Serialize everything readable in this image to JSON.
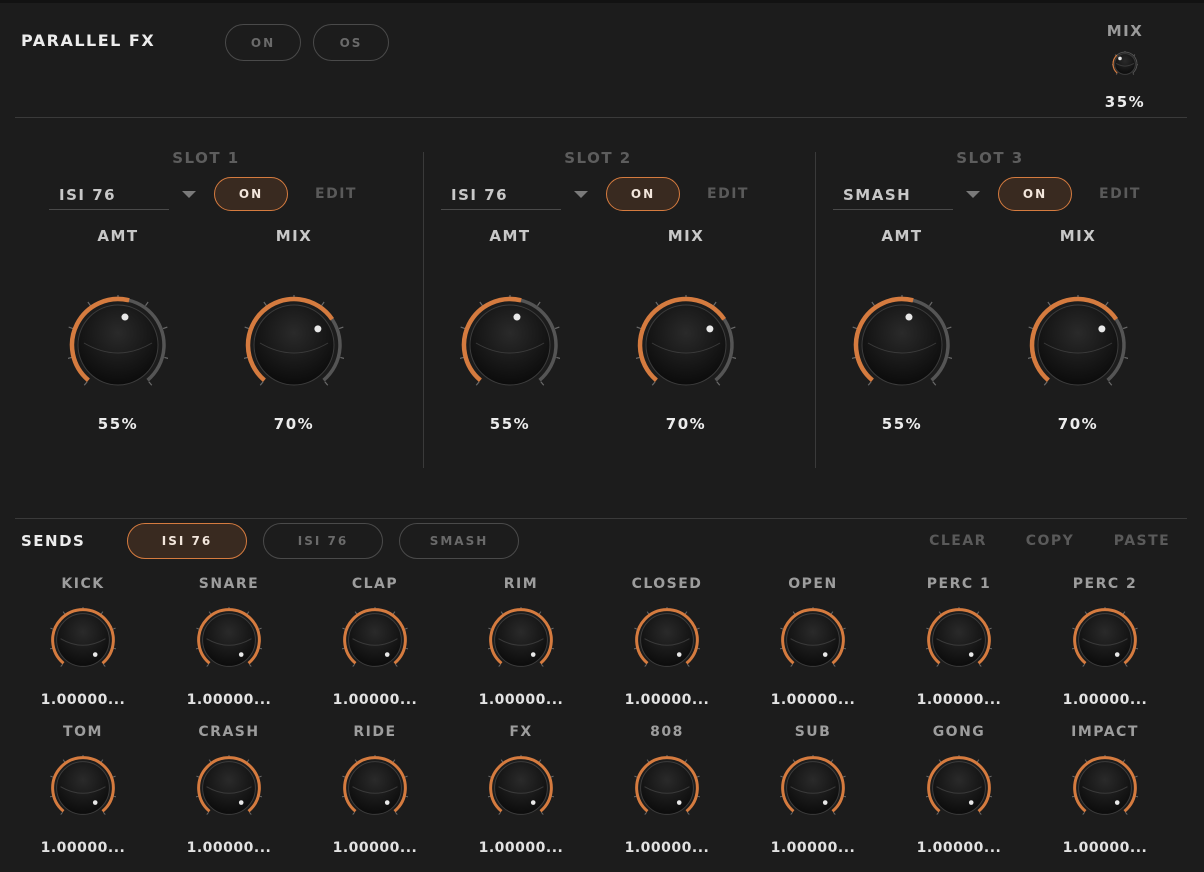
{
  "header": {
    "title": "PARALLEL FX",
    "buttons": [
      {
        "label": "ON",
        "active": false
      },
      {
        "label": "OS",
        "active": false
      }
    ],
    "mix": {
      "label": "MIX",
      "value": "35%",
      "level": 0.35
    }
  },
  "slots": [
    {
      "title": "SLOT 1",
      "effect": "ISI 76",
      "on_label": "ON",
      "on_active": true,
      "edit_label": "EDIT",
      "knobs": [
        {
          "label": "AMT",
          "value": "55%",
          "level": 0.55
        },
        {
          "label": "MIX",
          "value": "70%",
          "level": 0.7
        }
      ]
    },
    {
      "title": "SLOT 2",
      "effect": "ISI 76",
      "on_label": "ON",
      "on_active": true,
      "edit_label": "EDIT",
      "knobs": [
        {
          "label": "AMT",
          "value": "55%",
          "level": 0.55
        },
        {
          "label": "MIX",
          "value": "70%",
          "level": 0.7
        }
      ]
    },
    {
      "title": "SLOT 3",
      "effect": "SMASH",
      "on_label": "ON",
      "on_active": true,
      "edit_label": "EDIT",
      "knobs": [
        {
          "label": "AMT",
          "value": "55%",
          "level": 0.55
        },
        {
          "label": "MIX",
          "value": "70%",
          "level": 0.7
        }
      ]
    }
  ],
  "sends": {
    "title": "SENDS",
    "tabs": [
      {
        "label": "ISI 76",
        "active": true
      },
      {
        "label": "ISI 76",
        "active": false
      },
      {
        "label": "SMASH",
        "active": false
      }
    ],
    "actions": [
      "CLEAR",
      "COPY",
      "PASTE"
    ],
    "channels": [
      {
        "label": "KICK",
        "value": "1.00000..."
      },
      {
        "label": "SNARE",
        "value": "1.00000..."
      },
      {
        "label": "CLAP",
        "value": "1.00000..."
      },
      {
        "label": "RIM",
        "value": "1.00000..."
      },
      {
        "label": "CLOSED",
        "value": "1.00000..."
      },
      {
        "label": "OPEN",
        "value": "1.00000..."
      },
      {
        "label": "PERC 1",
        "value": "1.00000..."
      },
      {
        "label": "PERC 2",
        "value": "1.00000..."
      },
      {
        "label": "TOM",
        "value": "1.00000..."
      },
      {
        "label": "CRASH",
        "value": "1.00000..."
      },
      {
        "label": "RIDE",
        "value": "1.00000..."
      },
      {
        "label": "FX",
        "value": "1.00000..."
      },
      {
        "label": "808",
        "value": "1.00000..."
      },
      {
        "label": "SUB",
        "value": "1.00000..."
      },
      {
        "label": "GONG",
        "value": "1.00000..."
      },
      {
        "label": "IMPACT",
        "value": "1.00000..."
      }
    ],
    "level": 1.0
  },
  "colors": {
    "accent": "#d57b3f",
    "track": "#555555",
    "background": "#1c1c1c"
  }
}
